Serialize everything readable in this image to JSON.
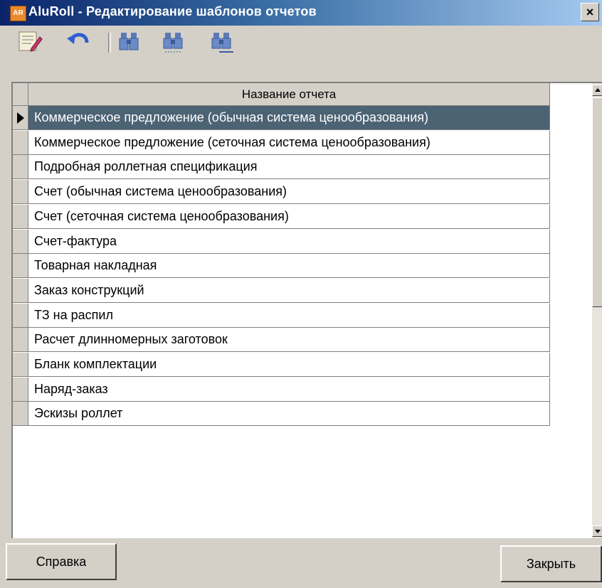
{
  "window": {
    "title": "AluRoll - Редактирование шаблонов отчетов",
    "app_icon_text": "AR",
    "close_glyph": "×"
  },
  "toolbar": {
    "icons": [
      "edit-notepad-icon",
      "undo-icon",
      "binoculars-find-icon",
      "binoculars-find-prev-icon",
      "binoculars-find-next-icon"
    ]
  },
  "grid": {
    "column_header": "Название отчета",
    "selected_index": 0,
    "rows": [
      "Коммерческое предложение (обычная система ценообразования)",
      "Коммерческое предложение (сеточная система ценообразования)",
      "Подробная роллетная спецификация",
      "Счет (обычная система ценообразования)",
      "Счет (сеточная система ценообразования)",
      "Счет-фактура",
      "Товарная накладная",
      "Заказ конструкций",
      "ТЗ на распил",
      "Расчет длинномерных заготовок",
      "Бланк комплектации",
      "Наряд-заказ",
      "Эскизы роллет"
    ]
  },
  "buttons": {
    "help": "Справка",
    "close": "Закрыть"
  },
  "colors": {
    "selection": "#4c6374",
    "titlebar_start": "#0a246a",
    "titlebar_end": "#a6caf0"
  }
}
